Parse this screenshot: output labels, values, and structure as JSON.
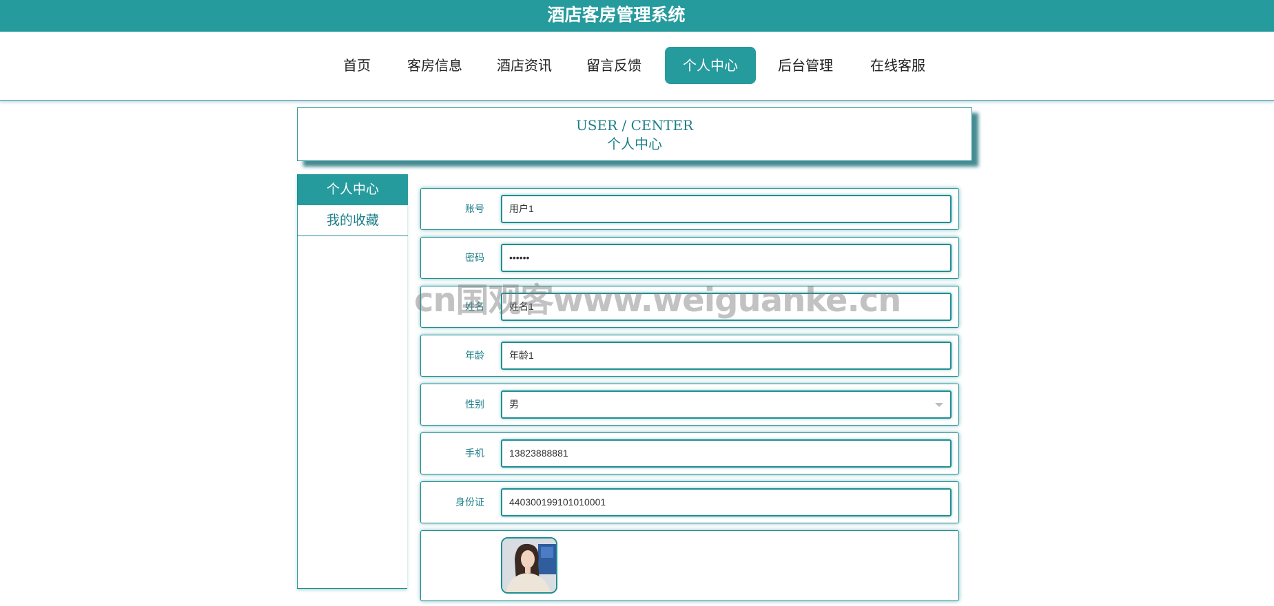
{
  "header": {
    "site_title": "酒店客房管理系统"
  },
  "nav": {
    "items": [
      {
        "label": "首页",
        "active": false
      },
      {
        "label": "客房信息",
        "active": false
      },
      {
        "label": "酒店资讯",
        "active": false
      },
      {
        "label": "留言反馈",
        "active": false
      },
      {
        "label": "个人中心",
        "active": true
      },
      {
        "label": "后台管理",
        "active": false
      },
      {
        "label": "在线客服",
        "active": false
      }
    ]
  },
  "page_header": {
    "en": "USER / CENTER",
    "zh": "个人中心"
  },
  "side_menu": {
    "items": [
      {
        "label": "个人中心",
        "active": true
      },
      {
        "label": "我的收藏",
        "active": false
      }
    ]
  },
  "form": {
    "account": {
      "label": "账号",
      "value": "用户1"
    },
    "password": {
      "label": "密码",
      "value": "••••••"
    },
    "name": {
      "label": "姓名",
      "value": "姓名1"
    },
    "age": {
      "label": "年龄",
      "value": "年龄1"
    },
    "gender": {
      "label": "性别",
      "value": "男"
    },
    "phone": {
      "label": "手机",
      "value": "13823888881"
    },
    "id_card": {
      "label": "身份证",
      "value": "440300199101010001"
    }
  },
  "avatar": {
    "icon": "user-avatar-photo"
  },
  "watermark": {
    "text": "cn国观客www.weiguanke.cn"
  },
  "colors": {
    "primary": "#269b9d",
    "accent_text": "#1e7f8a"
  }
}
